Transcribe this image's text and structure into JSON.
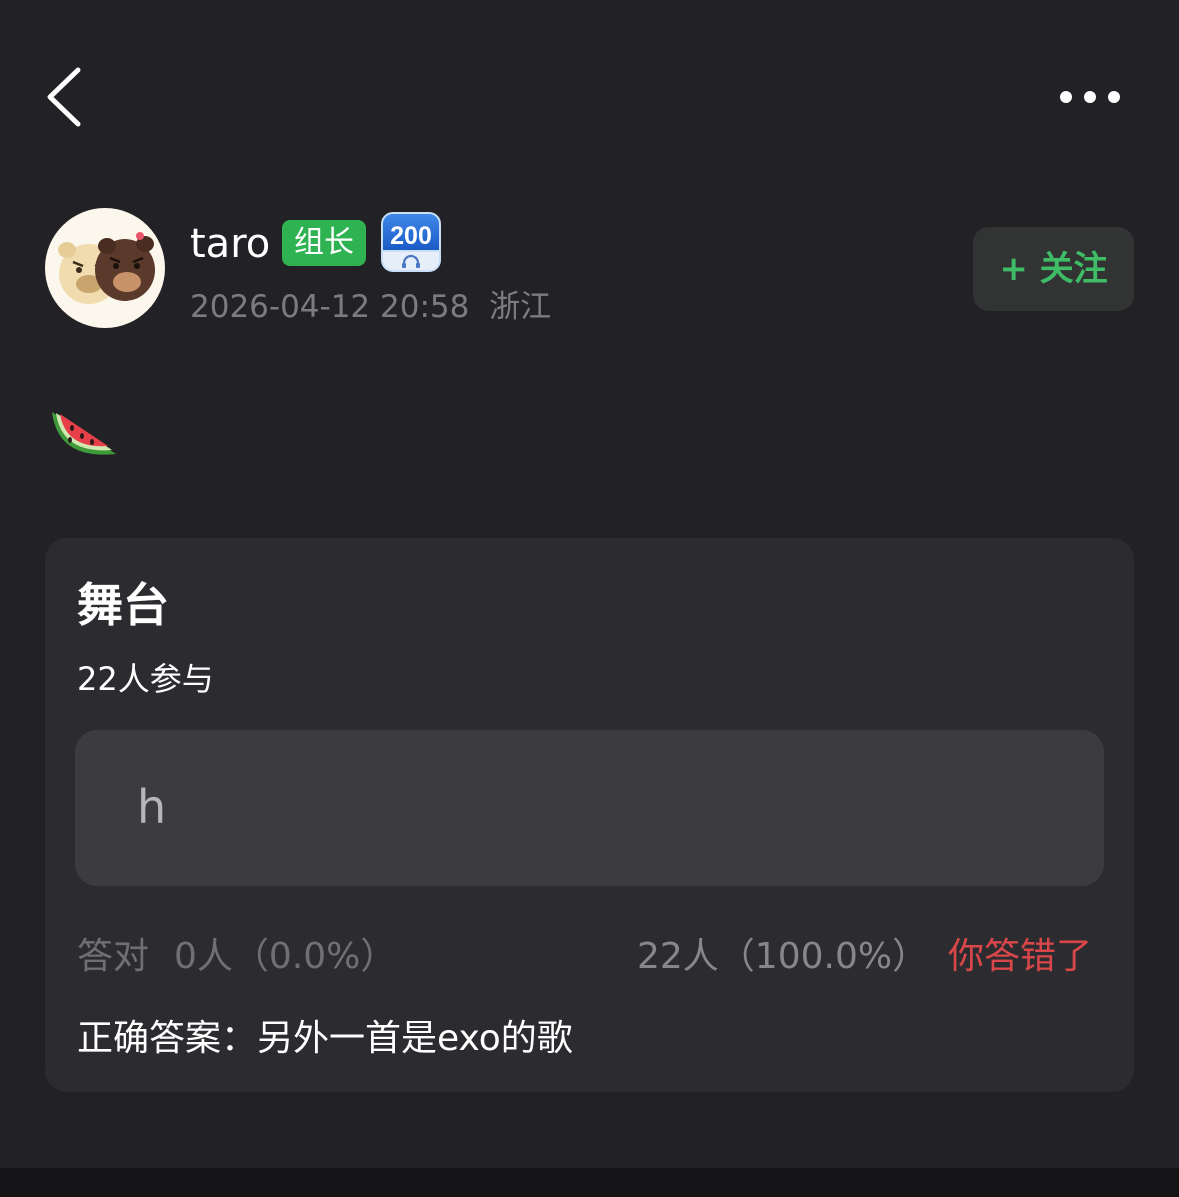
{
  "nav": {
    "back_icon": "chevron-left-icon",
    "more_icon": "more-horizontal-icon"
  },
  "author": {
    "username": "taro",
    "role_badge": "组长",
    "level": "200",
    "timestamp": "2026-04-12 20:58",
    "location": "浙江",
    "follow_label": "+ 关注",
    "avatar": "cartoon-animals-avatar"
  },
  "post": {
    "emoji_icon": "watermelon-icon"
  },
  "quiz": {
    "title": "舞台",
    "participants": "22人参与",
    "option_text": "h",
    "correct_label": "答对",
    "correct_count": "0人（0.0%）",
    "wrong_count": "22人（100.0%）",
    "result_text": "你答错了",
    "correct_answer": "正确答案：另外一首是exo的歌"
  },
  "colors": {
    "background": "#222226",
    "card": "#2c2c30",
    "option": "#3b3b40",
    "accent_green": "#3fbd66",
    "badge_green": "#2fb352",
    "error_red": "#d9474a",
    "muted_text": "#6f6f75"
  }
}
